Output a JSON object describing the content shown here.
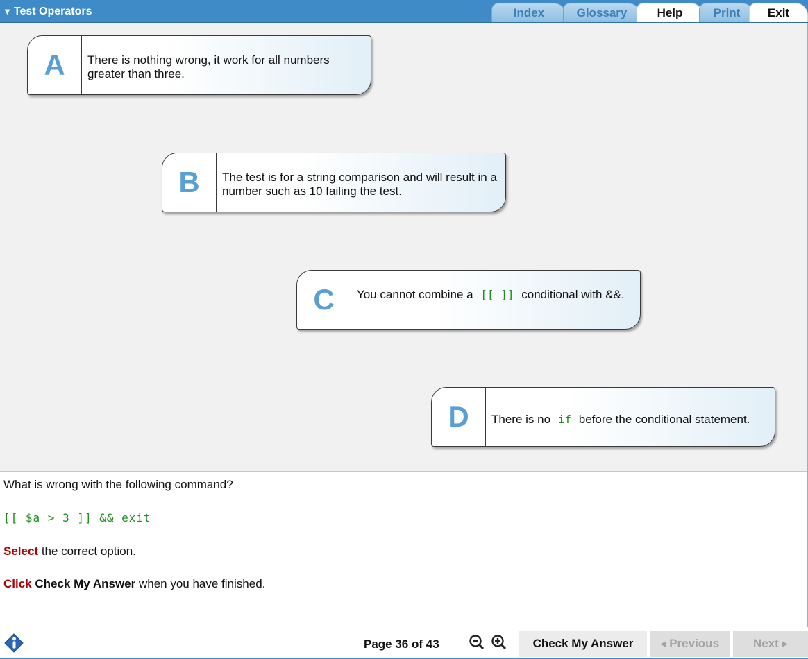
{
  "header": {
    "title": "Test Operators",
    "tabs": [
      {
        "label": "Index",
        "active": false
      },
      {
        "label": "Glossary",
        "active": false
      },
      {
        "label": "Help",
        "active": true
      },
      {
        "label": "Print",
        "active": false
      },
      {
        "label": "Exit",
        "active": true
      }
    ]
  },
  "options": [
    {
      "letter": "A",
      "text_parts": [
        "There is nothing wrong, it work for all numbers greater than three."
      ]
    },
    {
      "letter": "B",
      "text_parts": [
        "The test is for a string comparison and will result in a number such as 10 failing the test."
      ]
    },
    {
      "letter": "C",
      "text_before": "You cannot combine a ",
      "code": "[[ ]]",
      "text_after": " conditional with &&."
    },
    {
      "letter": "D",
      "text_before": "There is no ",
      "code": "if",
      "text_after": " before the conditional statement."
    }
  ],
  "question": {
    "prompt": "What is wrong with the following command?",
    "command": "[[ $a > 3 ]] && exit",
    "instruction1_action": "Select",
    "instruction1_rest": " the correct option.",
    "instruction2_action": "Click",
    "instruction2_bold": "Check My Answer",
    "instruction2_rest": " when you have finished."
  },
  "footer": {
    "page_label": "Page 36 of 43",
    "check_label": "Check My Answer",
    "prev_label": "◂ Previous",
    "next_label": "Next ▸",
    "icons": [
      "info-icon",
      "zoom-out-icon",
      "zoom-in-icon"
    ]
  },
  "colors": {
    "header_bg": "#3e8bc7",
    "letter": "#5a9fd4",
    "code": "#1e8c1e",
    "action_red": "#b00000"
  }
}
